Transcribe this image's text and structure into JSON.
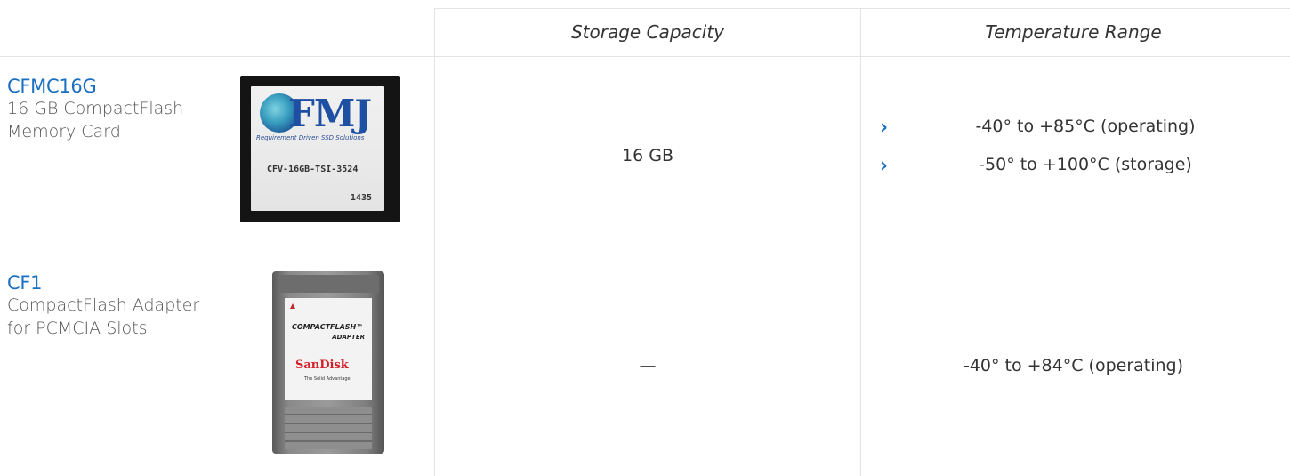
{
  "table": {
    "headers": {
      "storage": "Storage Capacity",
      "temperature": "Temperature Range"
    },
    "rows": [
      {
        "product_code": "CFMC16G",
        "description_line1": "16 GB CompactFlash",
        "description_line2": "Memory Card",
        "image": {
          "brand": "FMJ",
          "tagline": "Requirement Driven SSD Solutions",
          "part_number": "CFV-16GB-TSI-3524",
          "lot": "1435"
        },
        "storage": "16 GB",
        "temperature": [
          "-40° to +85°C (operating)",
          "-50° to +100°C (storage)"
        ]
      },
      {
        "product_code": "CF1",
        "description_line1": "CompactFlash Adapter",
        "description_line2": "for PCMCIA Slots",
        "image": {
          "title": "COMPACTFLASH™",
          "subtitle": "ADAPTER",
          "brand": "SanDisk",
          "tagline": "The Solid Advantage"
        },
        "storage": "—",
        "temperature": [
          "-40° to +84°C (operating)"
        ]
      }
    ]
  },
  "icons": {
    "bullet": "chevron-right-icon"
  },
  "colors": {
    "link": "#1a6fc0",
    "border": "#e3e3e3"
  }
}
